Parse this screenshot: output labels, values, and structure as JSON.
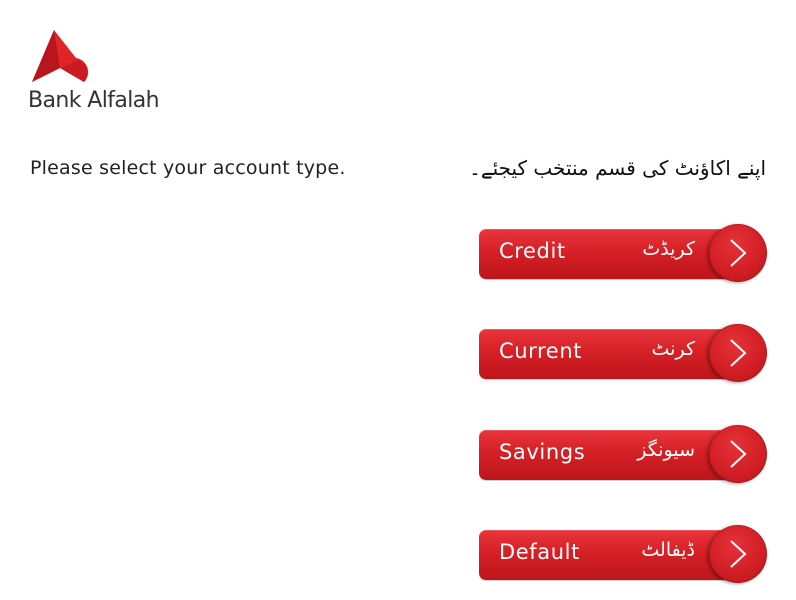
{
  "brand": {
    "name": "Bank Alfalah",
    "logo_icon": "alfalah-heart-arrow-icon",
    "accent_color": "#d52026"
  },
  "prompt": {
    "english": "Please select your account type.",
    "urdu": "اپنے اکاؤنٹ کی قسم منتخب کیجئے۔"
  },
  "options": [
    {
      "label_en": "Credit",
      "label_ur": "کریڈٹ",
      "icon": "chevron-right-icon"
    },
    {
      "label_en": "Current",
      "label_ur": "کرنٹ",
      "icon": "chevron-right-icon"
    },
    {
      "label_en": "Savings",
      "label_ur": "سیونگز",
      "icon": "chevron-right-icon"
    },
    {
      "label_en": "Default",
      "label_ur": "ڈیفالٹ",
      "icon": "chevron-right-icon"
    }
  ]
}
